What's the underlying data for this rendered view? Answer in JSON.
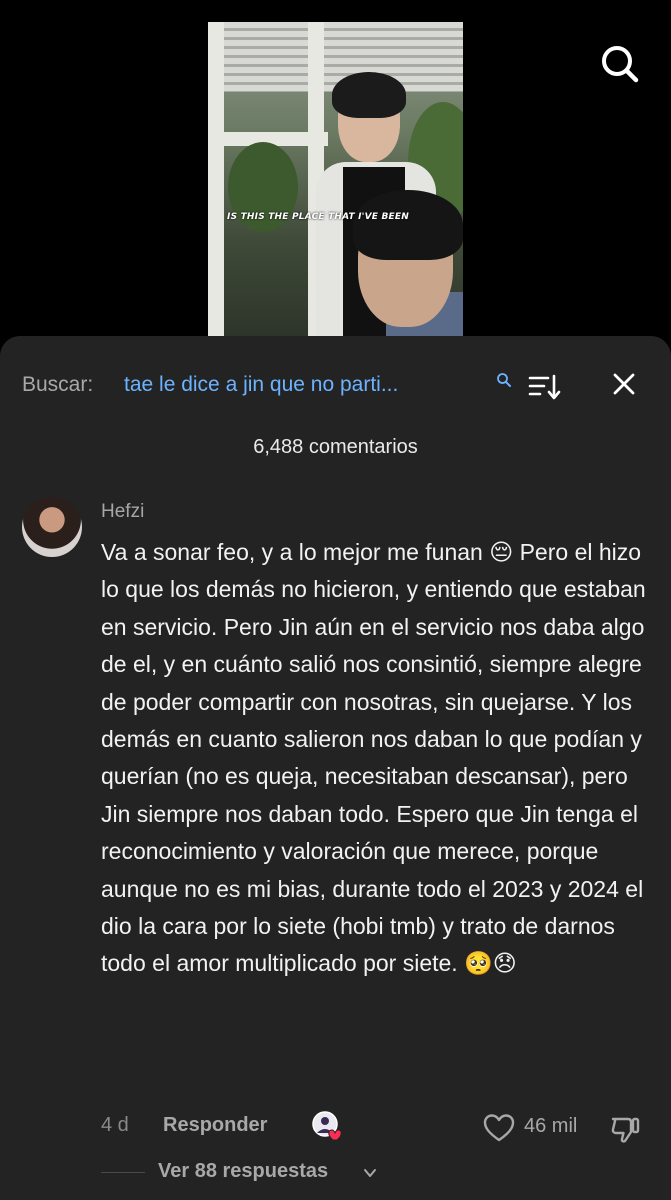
{
  "video": {
    "caption": "IS THIS THE PLACE THAT I'VE BEEN"
  },
  "search": {
    "label": "Buscar:",
    "query": "tae le dice a jin que no parti..."
  },
  "comments": {
    "count_text": "6,488 comentarios",
    "items": [
      {
        "author": "Hefzi",
        "text": "Va a sonar feo, y a lo mejor me funan 😔 Pero el hizo lo que los demás no hicieron, y entiendo que estaban en servicio. Pero Jin aún en el servicio nos daba algo de el, y en cuánto salió nos consintió, siempre alegre de poder compartir con nosotras, sin quejarse. Y los demás en cuanto salieron nos daban lo que podían y querían (no es queja, necesitaban descansar), pero Jin siempre nos daban todo. Espero que Jin tenga el reconocimiento y valoración que merece, porque aunque no es mi bias, durante todo el 2023 y 2024 el dio la cara por lo siete (hobi tmb) y trato de darnos todo el amor multiplicado por siete. 🥺😞",
        "time": "4 d",
        "reply_label": "Responder",
        "likes": "46 mil",
        "replies_label": "Ver 88 respuestas"
      }
    ]
  },
  "icons": {
    "top_search": "search-icon",
    "query_search": "search-icon",
    "sort": "sort-icon",
    "close": "close-icon",
    "like": "heart-icon",
    "dislike": "thumbs-down-icon",
    "expand": "chevron-down-icon"
  },
  "colors": {
    "background": "#000000",
    "sheet": "#232323",
    "link": "#6cb3ff",
    "muted": "#a8a8a8"
  }
}
